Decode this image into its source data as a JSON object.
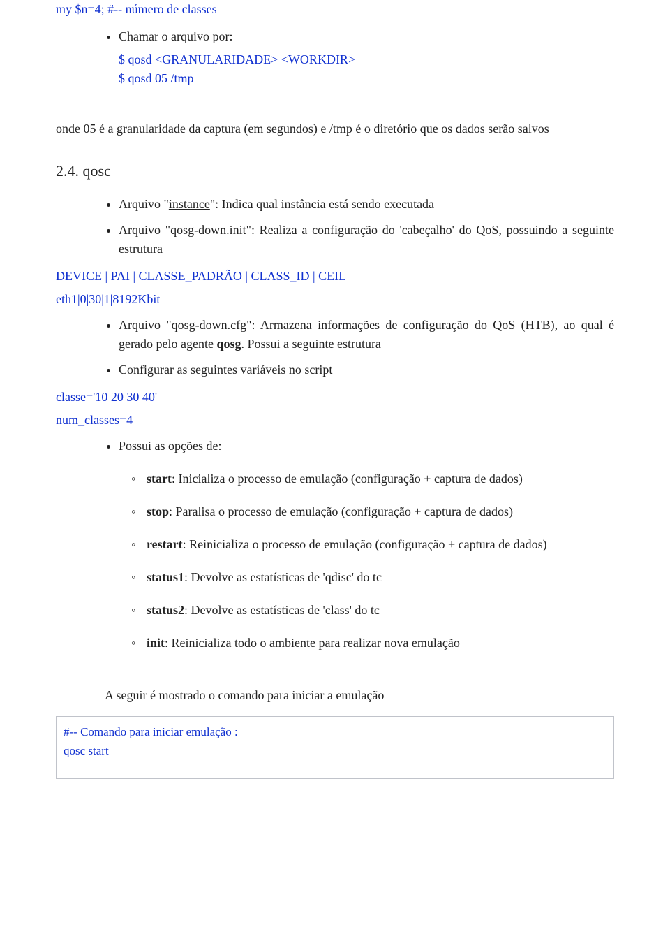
{
  "top_code": "my $n=4;   #-- número de classes",
  "b1": {
    "t1": "Chamar o arquivo por:",
    "c1": "$ qosd <GRANULARIDADE> <WORKDIR>",
    "c2": "$ qosd 05 /tmp",
    "t2_pre": "onde 05 é a granularidade da captura (em segundos) e /tmp é o diretório que os dados serão salvos"
  },
  "section": "2.4.  qosc",
  "b2": {
    "i1_a": "Arquivo \"",
    "i1_u": "instance",
    "i1_b": "\": Indica qual instância está sendo executada",
    "i2_a": "Arquivo \"",
    "i2_u": "qosg-down.init",
    "i2_b": "\": Realiza a configuração do 'cabeçalho' do QoS, possuindo a seguinte estrutura"
  },
  "c3": "DEVICE | PAI | CLASSE_PADRÃO | CLASS_ID | CEIL",
  "c4": "eth1|0|30|1|8192Kbit",
  "b3": {
    "i1_a": "Arquivo \"",
    "i1_u": "qosg-down.cfg",
    "i1_b": "\": Armazena informações de configuração do QoS (HTB), ao qual é gerado pelo agente ",
    "i1_bold": "qosg",
    "i1_c": ". Possui a seguinte estrutura",
    "i2": "Configurar as seguintes variáveis no script"
  },
  "c5": "classe='10 20 30 40'",
  "c6": "num_classes=4",
  "b4": {
    "i1": "Possui as opções de:"
  },
  "sub": {
    "s1b": "start",
    "s1": ": Inicializa o processo de emulação (configuração + captura de dados)",
    "s2b": "stop",
    "s2": ": Paralisa o processo de emulação (configuração + captura de dados)",
    "s3b": "restart",
    "s3": ": Reinicializa o processo de emulação (configuração + captura de dados)",
    "s4b": "status1",
    "s4": ": Devolve as estatísticas de 'qdisc' do tc",
    "s5b": "status2",
    "s5": ": Devolve as estatísticas de 'class' do tc",
    "s6b": "init",
    "s6": ": Reinicializa todo o ambiente para realizar nova emulação"
  },
  "closing": "A seguir é mostrado o comando para iniciar a emulação",
  "footer": {
    "l1": "#-- Comando para iniciar emulação :",
    "l2": "qosc start"
  }
}
